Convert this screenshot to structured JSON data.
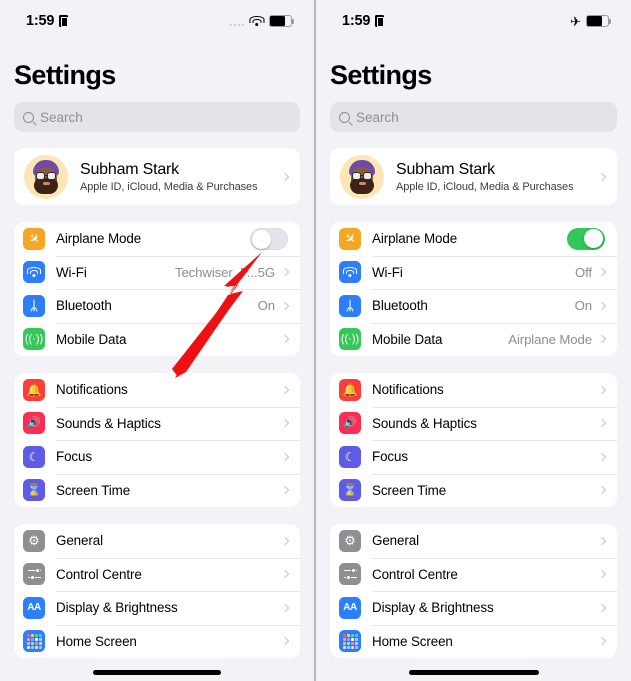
{
  "panels": [
    {
      "id": "before",
      "status": {
        "time": "1:59",
        "lock_icon": "lock-portrait-icon",
        "signal_icon": "signal-dots-icon",
        "connectivity_icon": "wifi-icon",
        "battery_icon": "battery-icon",
        "battery_level": 72
      },
      "title": "Settings",
      "search": {
        "placeholder": "Search",
        "icon": "search-icon"
      },
      "profile": {
        "name": "Subham Stark",
        "subtitle": "Apple ID, iCloud, Media & Purchases",
        "avatar": "memoji-avatar"
      },
      "groups": [
        {
          "rows": [
            {
              "label": "Airplane Mode",
              "value": "",
              "icon": "airplane-icon",
              "color": "#f5a623",
              "control": "toggle",
              "toggle_on": false
            },
            {
              "label": "Wi-Fi",
              "value": "Techwiser_P...5G",
              "icon": "wifi-icon",
              "color": "#2d7ff9",
              "control": "chevron"
            },
            {
              "label": "Bluetooth",
              "value": "On",
              "icon": "bluetooth-icon",
              "color": "#2d7ff9",
              "control": "chevron"
            },
            {
              "label": "Mobile Data",
              "value": "",
              "icon": "mobile-data-icon",
              "color": "#34c759",
              "control": "chevron"
            }
          ]
        },
        {
          "rows": [
            {
              "label": "Notifications",
              "value": "",
              "icon": "bell-icon",
              "color": "#fc3d39",
              "control": "chevron"
            },
            {
              "label": "Sounds & Haptics",
              "value": "",
              "icon": "speaker-icon",
              "color": "#fc2d55",
              "control": "chevron"
            },
            {
              "label": "Focus",
              "value": "",
              "icon": "moon-icon",
              "color": "#5e5ce6",
              "control": "chevron"
            },
            {
              "label": "Screen Time",
              "value": "",
              "icon": "hourglass-icon",
              "color": "#5e5ce6",
              "control": "chevron"
            }
          ]
        },
        {
          "rows": [
            {
              "label": "General",
              "value": "",
              "icon": "gear-icon",
              "color": "#8e8e93",
              "control": "chevron"
            },
            {
              "label": "Control Centre",
              "value": "",
              "icon": "control-centre-icon",
              "color": "#8e8e93",
              "control": "chevron"
            },
            {
              "label": "Display & Brightness",
              "value": "",
              "icon": "display-brightness-icon",
              "color": "#2d7ff9",
              "control": "chevron"
            },
            {
              "label": "Home Screen",
              "value": "",
              "icon": "home-screen-icon",
              "color": "#2d7ff9",
              "control": "chevron"
            }
          ]
        }
      ],
      "annotation": {
        "type": "arrow",
        "color": "#ee1111",
        "points_to": "airplane-mode-toggle"
      }
    },
    {
      "id": "after",
      "status": {
        "time": "1:59",
        "lock_icon": "lock-portrait-icon",
        "connectivity_icon": "airplane-icon",
        "battery_icon": "battery-icon",
        "battery_level": 72
      },
      "title": "Settings",
      "search": {
        "placeholder": "Search",
        "icon": "search-icon"
      },
      "profile": {
        "name": "Subham Stark",
        "subtitle": "Apple ID, iCloud, Media & Purchases",
        "avatar": "memoji-avatar"
      },
      "groups": [
        {
          "rows": [
            {
              "label": "Airplane Mode",
              "value": "",
              "icon": "airplane-icon",
              "color": "#f5a623",
              "control": "toggle",
              "toggle_on": true
            },
            {
              "label": "Wi-Fi",
              "value": "Off",
              "icon": "wifi-icon",
              "color": "#2d7ff9",
              "control": "chevron"
            },
            {
              "label": "Bluetooth",
              "value": "On",
              "icon": "bluetooth-icon",
              "color": "#2d7ff9",
              "control": "chevron"
            },
            {
              "label": "Mobile Data",
              "value": "Airplane Mode",
              "icon": "mobile-data-icon",
              "color": "#34c759",
              "control": "chevron"
            }
          ]
        },
        {
          "rows": [
            {
              "label": "Notifications",
              "value": "",
              "icon": "bell-icon",
              "color": "#fc3d39",
              "control": "chevron"
            },
            {
              "label": "Sounds & Haptics",
              "value": "",
              "icon": "speaker-icon",
              "color": "#fc2d55",
              "control": "chevron"
            },
            {
              "label": "Focus",
              "value": "",
              "icon": "moon-icon",
              "color": "#5e5ce6",
              "control": "chevron"
            },
            {
              "label": "Screen Time",
              "value": "",
              "icon": "hourglass-icon",
              "color": "#5e5ce6",
              "control": "chevron"
            }
          ]
        },
        {
          "rows": [
            {
              "label": "General",
              "value": "",
              "icon": "gear-icon",
              "color": "#8e8e93",
              "control": "chevron"
            },
            {
              "label": "Control Centre",
              "value": "",
              "icon": "control-centre-icon",
              "color": "#8e8e93",
              "control": "chevron"
            },
            {
              "label": "Display & Brightness",
              "value": "",
              "icon": "display-brightness-icon",
              "color": "#2d7ff9",
              "control": "chevron"
            },
            {
              "label": "Home Screen",
              "value": "",
              "icon": "home-screen-icon",
              "color": "#2d7ff9",
              "control": "chevron"
            }
          ]
        }
      ]
    }
  ],
  "theme": {
    "page_background": "#f2f2f7",
    "card_background": "#ffffff",
    "accent_green": "#32c759",
    "secondary_text": "#8e8e93",
    "annotation_red": "#ee1111"
  }
}
